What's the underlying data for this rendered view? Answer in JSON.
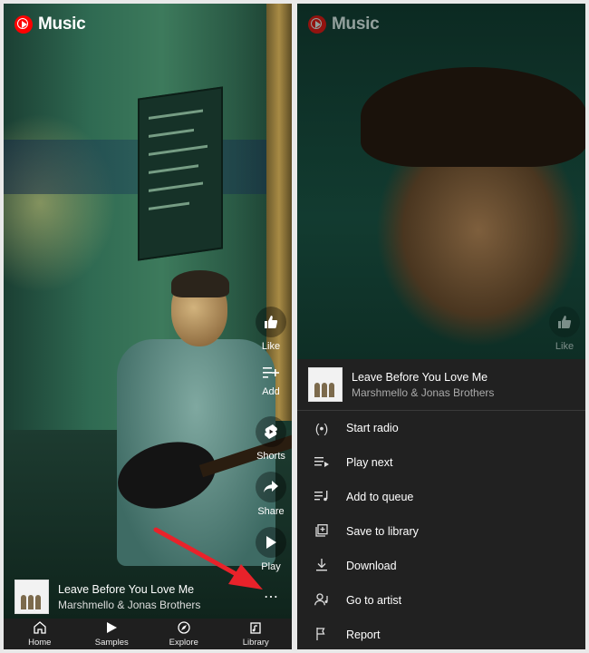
{
  "brand": {
    "name": "Music"
  },
  "left": {
    "actions": [
      {
        "label": "Like",
        "icon": "thumb-up-icon"
      },
      {
        "label": "Add",
        "icon": "playlist-add-icon"
      },
      {
        "label": "Shorts",
        "icon": "shorts-icon"
      },
      {
        "label": "Share",
        "icon": "share-icon"
      },
      {
        "label": "Play",
        "icon": "play-icon"
      }
    ],
    "now_playing": {
      "title": "Leave Before You Love Me",
      "artist": "Marshmello & Jonas Brothers"
    },
    "nav": [
      {
        "label": "Home",
        "icon": "home-icon"
      },
      {
        "label": "Samples",
        "icon": "samples-icon"
      },
      {
        "label": "Explore",
        "icon": "explore-icon"
      },
      {
        "label": "Library",
        "icon": "library-icon"
      }
    ]
  },
  "right": {
    "like_label": "Like",
    "sheet": {
      "title": "Leave Before You Love Me",
      "artist": "Marshmello & Jonas Brothers",
      "items": [
        {
          "label": "Start radio",
          "icon": "radio-icon"
        },
        {
          "label": "Play next",
          "icon": "play-next-icon"
        },
        {
          "label": "Add to queue",
          "icon": "queue-icon"
        },
        {
          "label": "Save to library",
          "icon": "save-library-icon"
        },
        {
          "label": "Download",
          "icon": "download-icon"
        },
        {
          "label": "Go to artist",
          "icon": "artist-icon"
        },
        {
          "label": "Report",
          "icon": "report-flag-icon"
        }
      ]
    }
  },
  "colors": {
    "brand_red": "#ff0000",
    "arrow_red": "#e8222a",
    "sheet_bg": "#212121"
  }
}
